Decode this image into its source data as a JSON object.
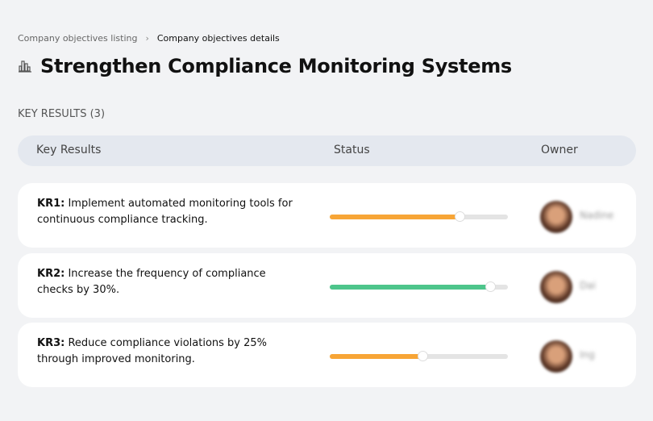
{
  "breadcrumb": {
    "parent": "Company objectives listing",
    "current": "Company objectives details"
  },
  "page_title": "Strengthen Compliance Monitoring Systems",
  "section_label": "KEY RESULTS (3)",
  "table": {
    "headers": {
      "key_results": "Key Results",
      "status": "Status",
      "owner": "Owner"
    },
    "rows": [
      {
        "code": "KR1:",
        "text": " Implement automated monitoring tools for continuous compliance tracking.",
        "progress": 73,
        "color": "#f7a536",
        "owner": "Nadine"
      },
      {
        "code": "KR2:",
        "text": " Increase the frequency of compliance checks by 30%.",
        "progress": 90,
        "color": "#4dc58b",
        "owner": "Dai"
      },
      {
        "code": "KR3:",
        "text": " Reduce compliance violations by 25% through improved monitoring.",
        "progress": 52,
        "color": "#f7a536",
        "owner": "Ing"
      }
    ]
  }
}
